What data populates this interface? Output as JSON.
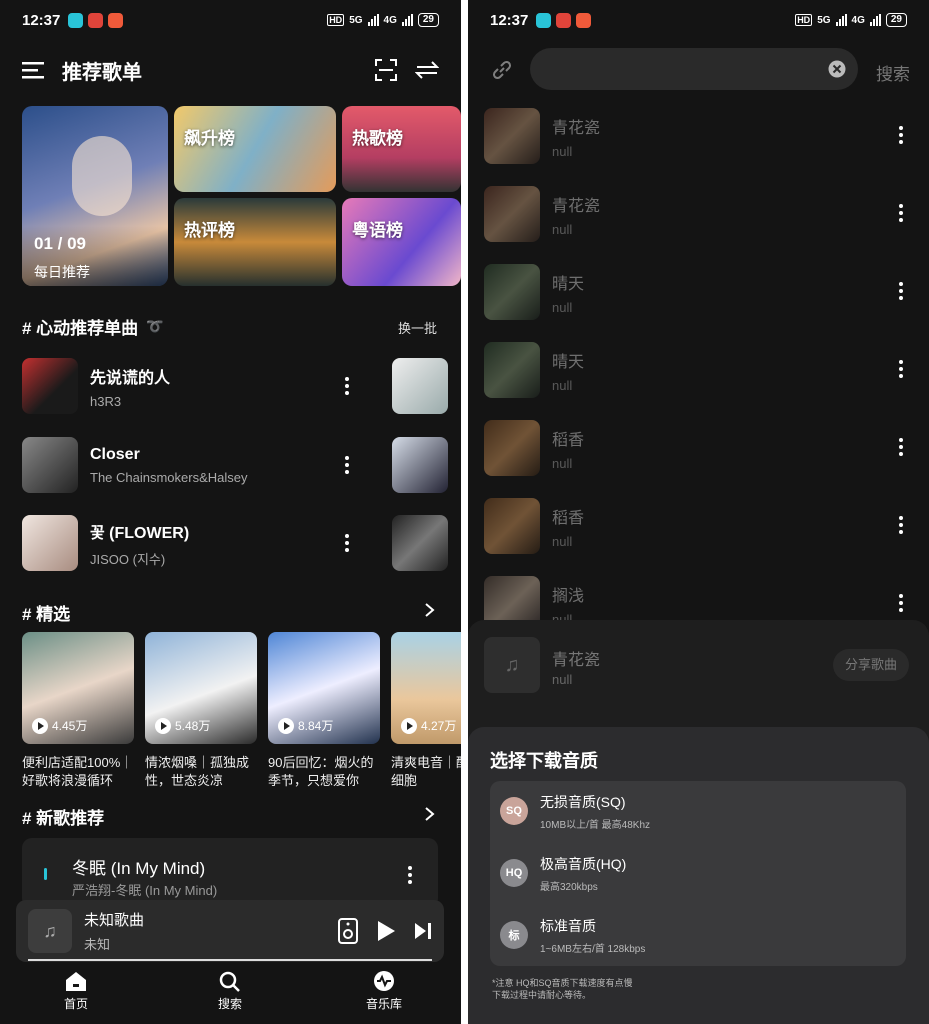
{
  "colors": {
    "background": "#141414",
    "accent": "#29c4d8",
    "sheet": "#2c2c2e"
  },
  "status": {
    "time": "12:37",
    "network_a": "5G",
    "network_b": "4G",
    "battery": "29",
    "hd": "HD"
  },
  "left": {
    "header": {
      "title": "推荐歌单"
    },
    "daily": {
      "date": "01 / 09",
      "label": "每日推荐"
    },
    "ranks": [
      "飙升榜",
      "热歌榜",
      "热评榜",
      "粤语榜"
    ],
    "section_hot": {
      "title": "# 心动推荐单曲",
      "action": "换一批"
    },
    "songs": [
      {
        "title": "先说谎的人",
        "artist": "h3R3"
      },
      {
        "title": "Closer",
        "artist": "The Chainsmokers&Halsey"
      },
      {
        "title": "꽃 (FLOWER)",
        "artist": "JISOO (지수)"
      }
    ],
    "section_pick": {
      "title": "# 精选"
    },
    "playlists": [
      {
        "plays": "4.45万",
        "desc": "便利店适配100%｜好歌将浪漫循环"
      },
      {
        "plays": "5.48万",
        "desc": "情浓烟嗓｜孤独成性，世态炎凉"
      },
      {
        "plays": "8.84万",
        "desc": "90后回忆：烟火的季节，只想爱你"
      },
      {
        "plays": "4.27万",
        "desc": "清爽电音｜醒快乐细胞"
      }
    ],
    "section_new": {
      "title": "# 新歌推荐"
    },
    "new_song": {
      "title": "冬眠 (In My Mind)",
      "sub": "严浩翔-冬眠 (In My Mind)"
    },
    "mini_player": {
      "title": "未知歌曲",
      "artist": "未知"
    },
    "nav": [
      "首页",
      "搜索",
      "音乐库"
    ]
  },
  "right": {
    "search": {
      "action": "搜索"
    },
    "results": [
      {
        "title": "青花瓷",
        "sub": "null"
      },
      {
        "title": "青花瓷",
        "sub": "null"
      },
      {
        "title": "晴天",
        "sub": "null"
      },
      {
        "title": "晴天",
        "sub": "null"
      },
      {
        "title": "稻香",
        "sub": "null"
      },
      {
        "title": "稻香",
        "sub": "null"
      },
      {
        "title": "搁浅",
        "sub": "null"
      }
    ],
    "share_song": {
      "title": "青花瓷",
      "sub": "null",
      "action": "分享歌曲"
    },
    "download": {
      "title": "选择下载音质",
      "options": [
        {
          "badge": "SQ",
          "label": "无损音质(SQ)",
          "sub": "10MB以上/首 最高48Khz",
          "color": "#c9a49a"
        },
        {
          "badge": "HQ",
          "label": "极高音质(HQ)",
          "sub": "最高320kbps",
          "color": "#8a8a8e"
        },
        {
          "badge": "标",
          "label": "标准音质",
          "sub": "1~6MB左右/首 128kbps",
          "color": "#8a8a8e"
        }
      ],
      "note_1": "*注意 HQ和SQ音质下载速度有点慢",
      "note_2": "下载过程中请耐心等待。"
    }
  }
}
